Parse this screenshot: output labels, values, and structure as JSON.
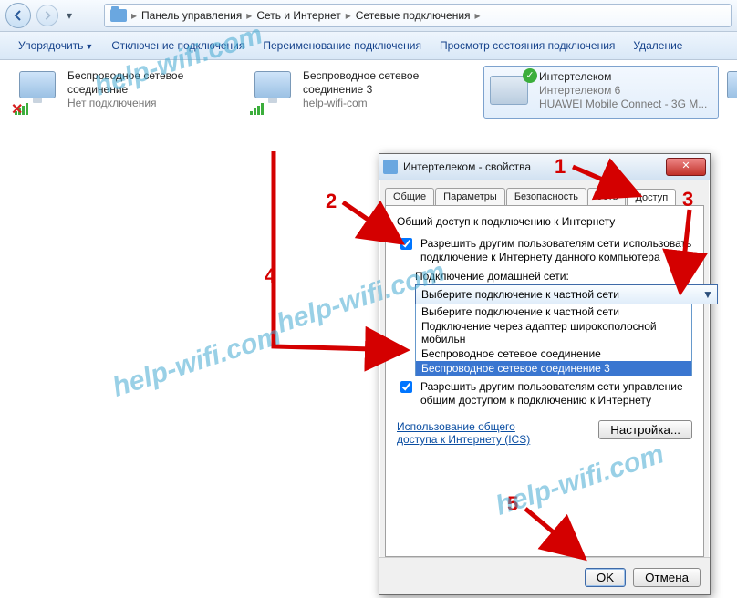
{
  "breadcrumb": {
    "p1": "Панель управления",
    "p2": "Сеть и Интернет",
    "p3": "Сетевые подключения"
  },
  "toolbar": {
    "organize": "Упорядочить",
    "disable": "Отключение подключения",
    "rename": "Переименование подключения",
    "status": "Просмотр состояния подключения",
    "delete": "Удаление"
  },
  "items": {
    "a": {
      "title": "Беспроводное сетевое соединение",
      "status": "Нет подключения"
    },
    "b": {
      "title": "Беспроводное сетевое соединение 3",
      "status": "help-wifi-com"
    },
    "c": {
      "title": "Интертелеком",
      "line2": "Интертелеком 6",
      "line3": "HUAWEI Mobile Connect - 3G M..."
    }
  },
  "dialog": {
    "title": "Интертелеком - свойства",
    "tabs": {
      "general": "Общие",
      "params": "Параметры",
      "security": "Безопасность",
      "network": "Сеть",
      "access": "Доступ"
    },
    "section": "Общий доступ к подключению к Интернету",
    "chk1": "Разрешить другим пользователям сети использовать подключение к Интернету данного компьютера",
    "homelabel": "Подключение домашней сети:",
    "combo_selected": "Выберите подключение к частной сети",
    "options": {
      "o1": "Выберите подключение к частной сети",
      "o2": "Подключение через адаптер широкополосной мобильн",
      "o3": "Беспроводное сетевое соединение",
      "o4": "Беспроводное сетевое соединение 3"
    },
    "chk2": "Разрешить другим пользователям сети управление общим доступом к подключению к Интернету",
    "ics_link": "Использование общего доступа к Интернету (ICS)",
    "settings_btn": "Настройка...",
    "ok": "OK",
    "cancel": "Отмена"
  },
  "annotations": {
    "n1": "1",
    "n2": "2",
    "n3": "3",
    "n4": "4",
    "n5": "5"
  },
  "watermark": "help-wifi.com"
}
